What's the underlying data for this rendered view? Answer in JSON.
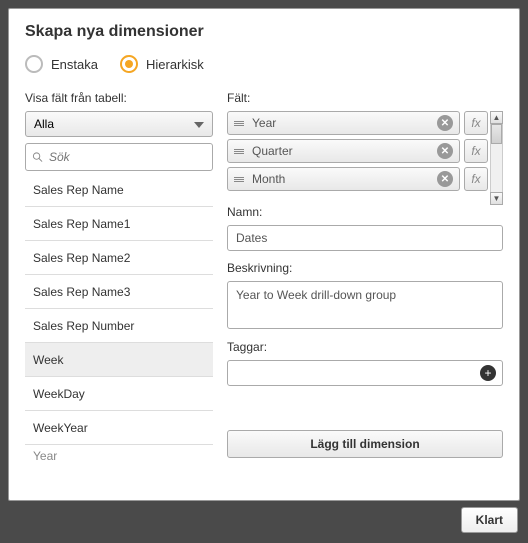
{
  "title": "Skapa nya dimensioner",
  "radios": {
    "single": "Enstaka",
    "hier": "Hierarkisk"
  },
  "left": {
    "label": "Visa fält från tabell:",
    "dropdown": "Alla",
    "searchPlaceholder": "Sök",
    "items": [
      "Sales Rep Name",
      "Sales Rep Name1",
      "Sales Rep Name2",
      "Sales Rep Name3",
      "Sales Rep Number",
      "Week",
      "WeekDay",
      "WeekYear",
      "Year"
    ]
  },
  "right": {
    "fieldsLabel": "Fält:",
    "fields": [
      "Year",
      "Quarter",
      "Month"
    ],
    "fx": "fx",
    "nameLabel": "Namn:",
    "nameValue": "Dates",
    "descLabel": "Beskrivning:",
    "descValue": "Year to Week drill-down group",
    "tagsLabel": "Taggar:",
    "addBtn": "Lägg till dimension"
  },
  "done": "Klart"
}
